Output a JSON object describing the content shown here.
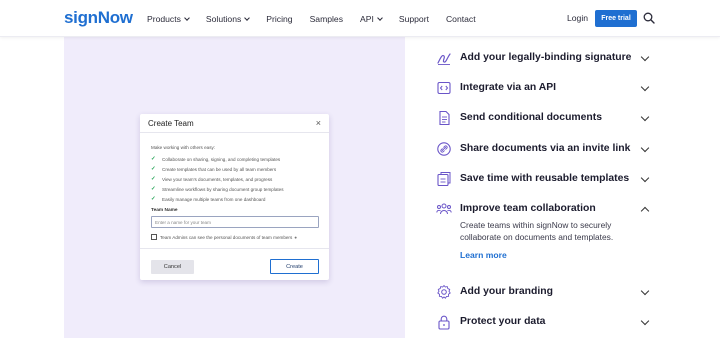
{
  "header": {
    "logo": "signNow",
    "nav": [
      {
        "label": "Products",
        "has_caret": true
      },
      {
        "label": "Solutions",
        "has_caret": true
      },
      {
        "label": "Pricing",
        "has_caret": false
      },
      {
        "label": "Samples",
        "has_caret": false
      },
      {
        "label": "API",
        "has_caret": true
      },
      {
        "label": "Support",
        "has_caret": false
      },
      {
        "label": "Contact",
        "has_caret": false
      }
    ],
    "login_label": "Login",
    "trial_label": "Free trial",
    "search_icon": "search-icon"
  },
  "modal": {
    "title": "Create Team",
    "close_glyph": "×",
    "intro": "Make working with others easy:",
    "checklist": [
      "Collaborate on sharing, signing, and completing templates",
      "Create templates that can be used by all team members",
      "View your team's documents, templates, and progress",
      "Streamline workflows by sharing document group templates",
      "Easily manage multiple teams from one dashboard"
    ],
    "team_name_label": "Team Name",
    "team_name_placeholder": "Enter a name for your team",
    "admin_checkbox_label": "Team Admins can see the personal documents of team members",
    "cancel_label": "Cancel",
    "create_label": "Create"
  },
  "accordion": {
    "items": [
      {
        "label": "Add your legally-binding signature",
        "icon": "signature-icon",
        "expanded": false
      },
      {
        "label": "Integrate via an API",
        "icon": "code-icon",
        "expanded": false
      },
      {
        "label": "Send conditional documents",
        "icon": "document-icon",
        "expanded": false
      },
      {
        "label": "Share documents via an invite link",
        "icon": "link-icon",
        "expanded": false
      },
      {
        "label": "Save time with reusable templates",
        "icon": "template-icon",
        "expanded": false
      },
      {
        "label": "Improve team collaboration",
        "icon": "team-icon",
        "expanded": true
      },
      {
        "label": "Add your branding",
        "icon": "branding-gear-icon",
        "expanded": false
      },
      {
        "label": "Protect your data",
        "icon": "lock-icon",
        "expanded": false
      }
    ],
    "expanded_description": "Create teams within signNow to securely collaborate on documents and templates.",
    "learn_more_label": "Learn more"
  },
  "colors": {
    "brand_blue": "#1f6fd1",
    "panel_lavender": "#f0ecfb",
    "check_green": "#2aa55a",
    "icon_purple": "#6a55c8"
  }
}
